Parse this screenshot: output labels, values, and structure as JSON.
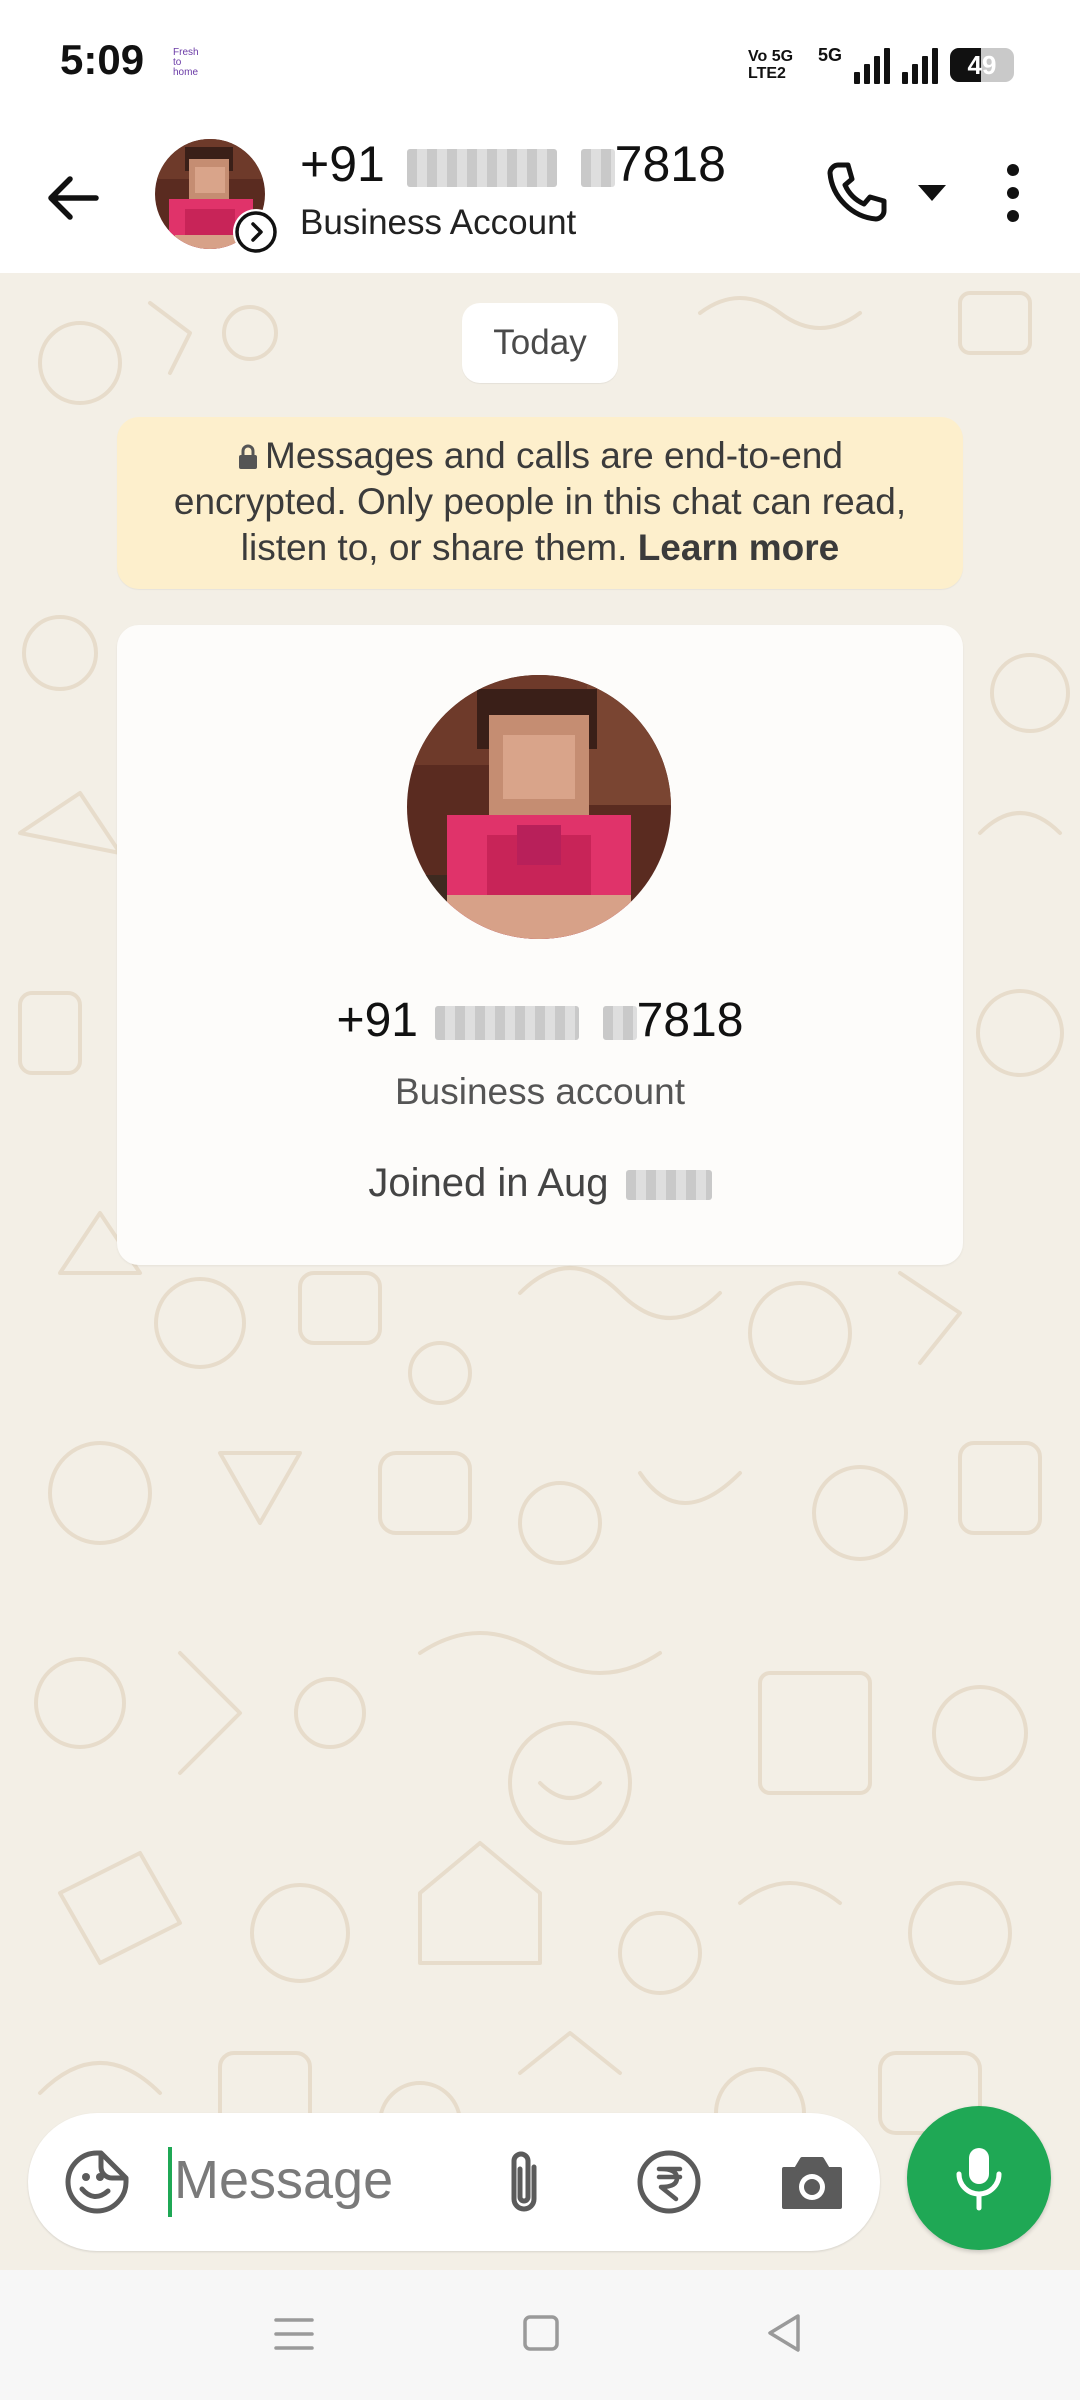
{
  "status_bar": {
    "time": "5:09",
    "app_icon_text": "Fresh to home",
    "volte_label_top": "Vo 5G",
    "volte_label_bottom": "LTE2",
    "network_label": "5G",
    "battery_level": "49",
    "battery_fraction": 0.49
  },
  "header": {
    "contact_prefix": "+91",
    "contact_suffix": "7818",
    "subtitle": "Business Account"
  },
  "chat": {
    "date_chip": "Today",
    "encryption_text": "Messages and calls are end-to-end encrypted. Only people in this chat can read, listen to, or share them.",
    "learn_more": "Learn more",
    "card": {
      "number_prefix": "+91",
      "number_suffix": "7818",
      "account_type": "Business account",
      "joined_prefix": "Joined in Aug"
    }
  },
  "composer": {
    "placeholder": "Message"
  },
  "colors": {
    "accent_green": "#1fa855",
    "chat_background": "#f3efe6",
    "notice_background": "#fdefcc"
  },
  "icons": {
    "back": "arrow-left-icon",
    "call": "phone-icon",
    "dropdown": "caret-down-icon",
    "more": "more-vertical-icon",
    "lock": "lock-icon",
    "emoji": "sticker-emoji-icon",
    "attach": "paperclip-icon",
    "payment": "rupee-icon",
    "camera": "camera-icon",
    "mic": "microphone-icon",
    "status": "status-play-icon"
  }
}
